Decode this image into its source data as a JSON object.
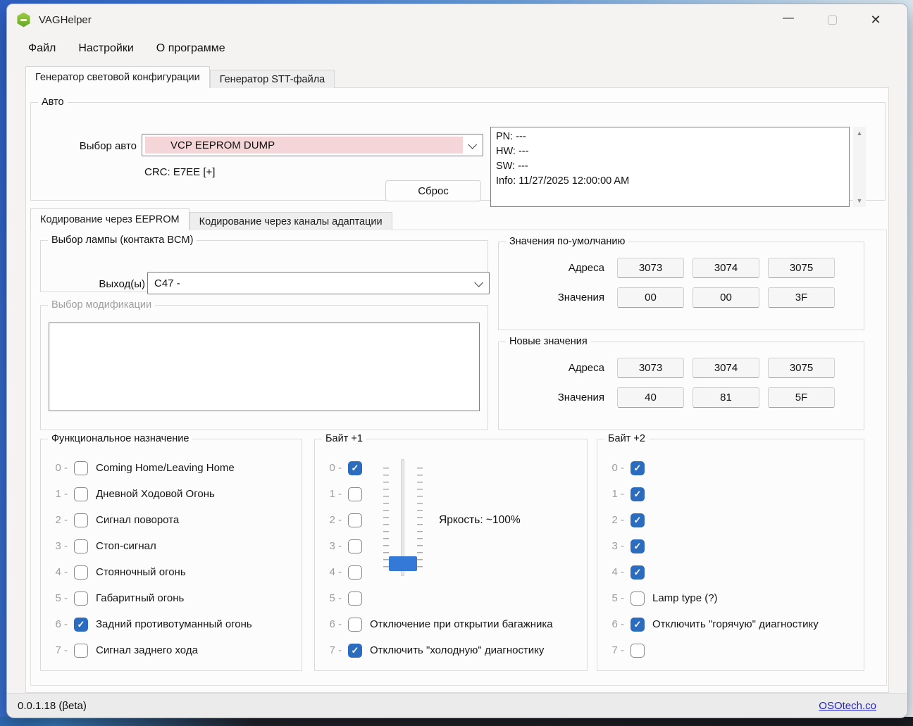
{
  "window": {
    "title": "VAGHelper"
  },
  "menu": {
    "items": [
      {
        "label": "Файл"
      },
      {
        "label": "Настройки"
      },
      {
        "label": "О программе"
      }
    ]
  },
  "main_tabs": [
    {
      "label": "Генератор световой конфигурации",
      "active": true
    },
    {
      "label": "Генератор STT-файла",
      "active": false
    }
  ],
  "auto": {
    "group_label": "Авто",
    "car_select_label": "Выбор авто",
    "car_select_value": "VCP EEPROM DUMP",
    "crc": "CRC: E7EE [+]",
    "reset_button": "Сброс",
    "info_lines": [
      "PN: ---",
      "HW: ---",
      "SW: ---",
      "Info: 11/27/2025 12:00:00 AM"
    ]
  },
  "coding_tabs": [
    {
      "label": "Кодирование через EEPROM",
      "active": true
    },
    {
      "label": "Кодирование через каналы адаптации",
      "active": false
    }
  ],
  "lamp_select": {
    "group_label": "Выбор лампы (контакта BCM)",
    "output_label": "Выход(ы)",
    "output_value": "C47 -"
  },
  "modification": {
    "group_label": "Выбор модификации"
  },
  "default_values": {
    "group_label": "Значения по-умолчанию",
    "address_label": "Адреса",
    "values_label": "Значения",
    "addresses": [
      "3073",
      "3074",
      "3075"
    ],
    "values": [
      "00",
      "00",
      "3F"
    ]
  },
  "new_values": {
    "group_label": "Новые значения",
    "address_label": "Адреса",
    "values_label": "Значения",
    "addresses": [
      "3073",
      "3074",
      "3075"
    ],
    "values": [
      "40",
      "81",
      "5F"
    ]
  },
  "functional": {
    "group_label": "Функциональное назначение",
    "items": [
      {
        "index_label": "0 -",
        "label": "Coming Home/Leaving Home",
        "checked": false
      },
      {
        "index_label": "1 -",
        "label": "Дневной Ходовой Огонь",
        "checked": false
      },
      {
        "index_label": "2 -",
        "label": "Сигнал поворота",
        "checked": false
      },
      {
        "index_label": "3 -",
        "label": "Стоп-сигнал",
        "checked": false
      },
      {
        "index_label": "4 -",
        "label": "Стояночный огонь",
        "checked": false
      },
      {
        "index_label": "5 -",
        "label": "Габаритный огонь",
        "checked": false
      },
      {
        "index_label": "6 -",
        "label": "Задний противотуманный огонь",
        "checked": true
      },
      {
        "index_label": "7 -",
        "label": "Сигнал заднего хода",
        "checked": false
      }
    ]
  },
  "byte1": {
    "group_label": "Байт +1",
    "brightness_label": "Яркость: ~100%",
    "items": [
      {
        "index_label": "0 -",
        "label": "",
        "checked": true
      },
      {
        "index_label": "1 -",
        "label": "",
        "checked": false
      },
      {
        "index_label": "2 -",
        "label": "",
        "checked": false
      },
      {
        "index_label": "3 -",
        "label": "",
        "checked": false
      },
      {
        "index_label": "4 -",
        "label": "",
        "checked": false
      },
      {
        "index_label": "5 -",
        "label": "",
        "checked": false
      },
      {
        "index_label": "6 -",
        "label": "Отключение при открытии багажника",
        "checked": false
      },
      {
        "index_label": "7 -",
        "label": "Отключить \"холодную\" диагностику",
        "checked": true
      }
    ]
  },
  "byte2": {
    "group_label": "Байт +2",
    "items": [
      {
        "index_label": "0 -",
        "label": "",
        "checked": true
      },
      {
        "index_label": "1 -",
        "label": "",
        "checked": true
      },
      {
        "index_label": "2 -",
        "label": "",
        "checked": true
      },
      {
        "index_label": "3 -",
        "label": "",
        "checked": true
      },
      {
        "index_label": "4 -",
        "label": "",
        "checked": true
      },
      {
        "index_label": "5 -",
        "label": "Lamp type (?)",
        "checked": false
      },
      {
        "index_label": "6 -",
        "label": "Отключить \"горячую\" диагностику",
        "checked": true
      },
      {
        "index_label": "7 -",
        "label": "",
        "checked": false
      }
    ]
  },
  "status_bar": {
    "version": "0.0.1.18 (βeta)",
    "link": "OSOtech.co"
  },
  "colors": {
    "checkbox_accent": "#2c6cbe",
    "combo_highlight": "#f5d6d8",
    "slider_handle": "#3579d6",
    "link": "#2323cf",
    "app_icon_green": "#7cb633"
  }
}
